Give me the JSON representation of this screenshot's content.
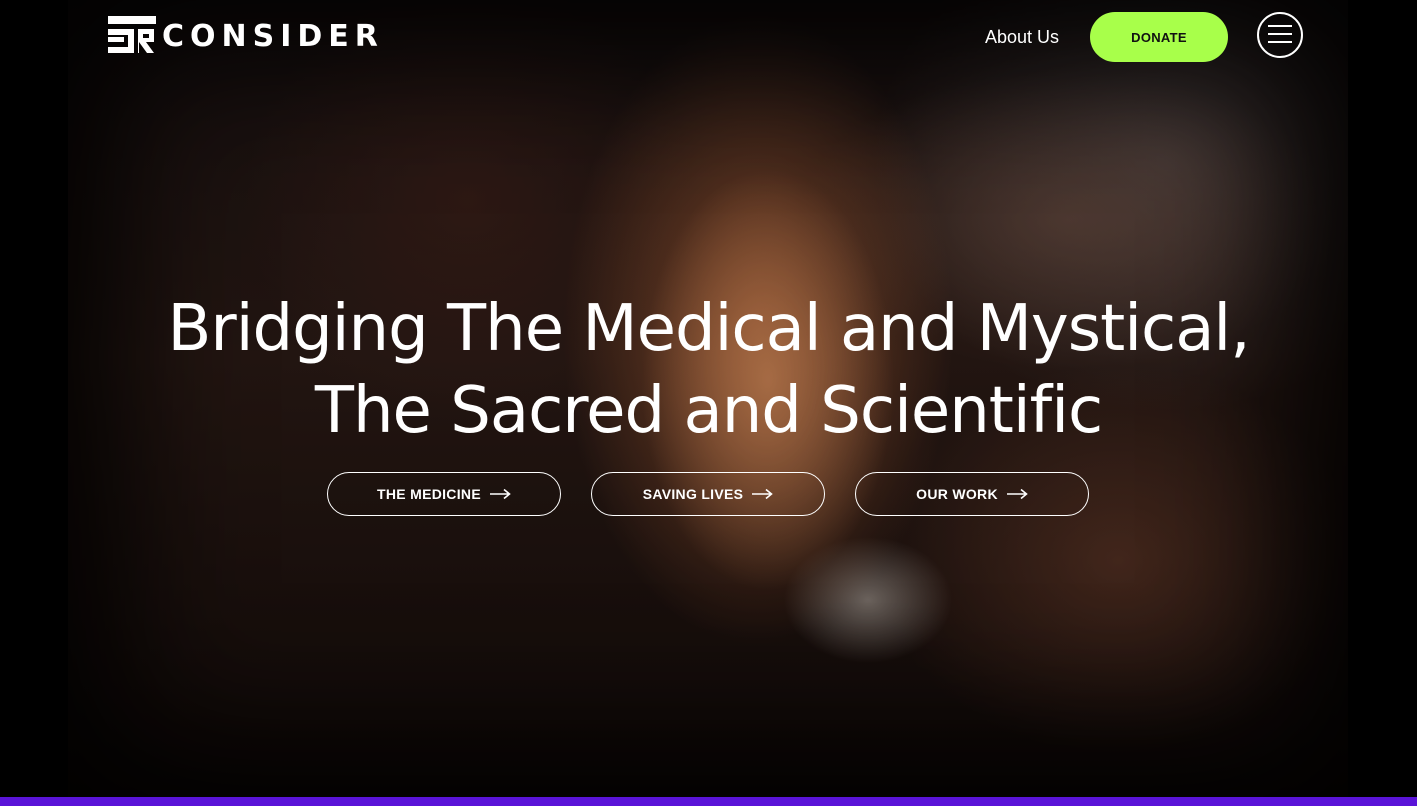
{
  "brand": {
    "logo_text": "CONSIDER",
    "logo_mark_letters": "RE",
    "accent_green": "#a8ff4a",
    "accent_purple": "#5a14d8"
  },
  "header": {
    "nav_about": "About Us",
    "donate_label": "DONATE",
    "menu_icon": "hamburger-menu-icon"
  },
  "hero": {
    "headline_line1": "Bridging The Medical and Mystical,",
    "headline_line2": "The Sacred and Scientific",
    "image_subject": "elderly praying hands",
    "ctas": [
      {
        "label": "THE MEDICINE",
        "icon": "arrow-right-icon"
      },
      {
        "label": "SAVING LIVES",
        "icon": "arrow-right-icon"
      },
      {
        "label": "OUR WORK",
        "icon": "arrow-right-icon"
      }
    ]
  }
}
